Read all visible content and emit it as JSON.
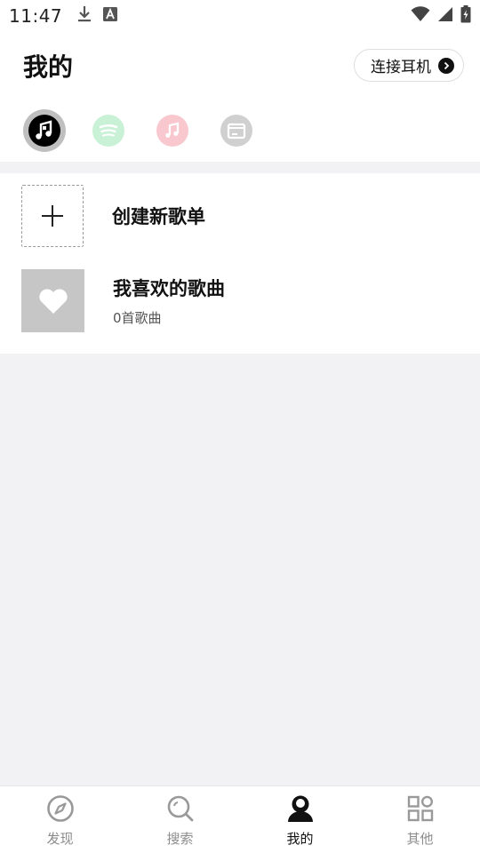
{
  "status_bar": {
    "time": "11:47",
    "left_icons": [
      "download-icon",
      "text-a-icon"
    ],
    "right_icons": [
      "wifi-icon",
      "cellular-signal-icon",
      "battery-charging-icon"
    ]
  },
  "header": {
    "title": "我的",
    "connect_button_label": "连接耳机"
  },
  "sources": [
    {
      "icon": "music-note-icon",
      "active": true,
      "color": "#000000"
    },
    {
      "icon": "spotify-icon",
      "active": false,
      "color": "#c8f1d6"
    },
    {
      "icon": "apple-music-icon",
      "active": false,
      "color": "#f9c8cf"
    },
    {
      "icon": "folder-icon",
      "active": false,
      "color": "#d0d0d0"
    }
  ],
  "playlists": {
    "create": {
      "label": "创建新歌单"
    },
    "favorites": {
      "title": "我喜欢的歌曲",
      "subtitle": "0首歌曲"
    }
  },
  "bottom_nav": {
    "items": [
      {
        "label": "发现",
        "icon": "compass-icon",
        "active": false
      },
      {
        "label": "搜索",
        "icon": "search-icon",
        "active": false
      },
      {
        "label": "我的",
        "icon": "profile-icon",
        "active": true
      },
      {
        "label": "其他",
        "icon": "grid-icon",
        "active": false
      }
    ]
  },
  "colors": {
    "background": "#f2f2f4",
    "active": "#111111",
    "inactive": "#8c8c8c"
  }
}
